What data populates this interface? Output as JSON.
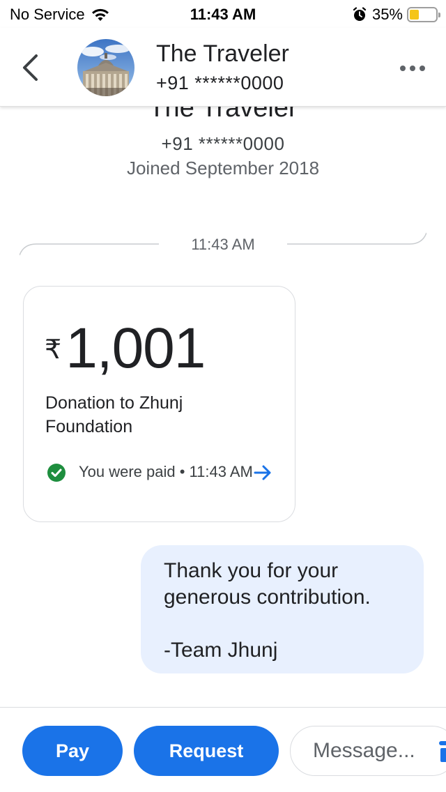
{
  "status_bar": {
    "carrier": "No Service",
    "time": "11:43 AM",
    "battery": "35%",
    "battery_level": 0.35,
    "icons": [
      "wifi-icon",
      "alarm-icon",
      "battery-icon"
    ]
  },
  "header": {
    "back_icon": "chevron-left-icon",
    "contact_name": "The Traveler",
    "contact_phone": "+91 ******0000",
    "more_icon": "more-horizontal-icon"
  },
  "profile": {
    "name": "The Traveler",
    "phone": "+91 ******0000",
    "joined": "Joined September 2018"
  },
  "conversation": {
    "divider_time": "11:43 AM",
    "payment": {
      "currency_symbol": "₹",
      "amount": "1,001",
      "description": "Donation to Zhunj Foundation",
      "status": "You were paid • 11:43 AM",
      "status_icon": "check-circle-icon",
      "link_icon": "arrow-right-icon"
    },
    "message": {
      "text": "Thank you for your generous contribution.\n\n-Team Jhunj"
    }
  },
  "bottom_bar": {
    "pay_label": "Pay",
    "request_label": "Request",
    "message_placeholder": "Message..."
  },
  "colors": {
    "accent": "#1a73e8",
    "bubble": "#e8f0fe",
    "success": "#1e8e3e",
    "battery_fill": "#f5c518"
  }
}
